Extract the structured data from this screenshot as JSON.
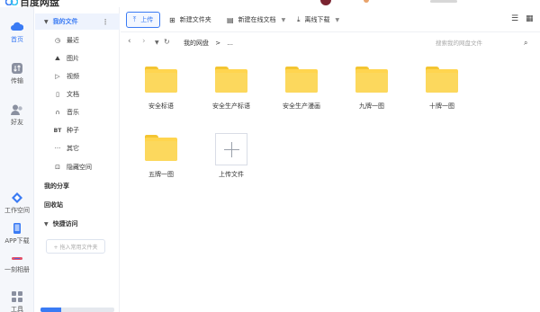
{
  "app": {
    "title": "百度网盘"
  },
  "rail": {
    "items": [
      {
        "label": "首页",
        "icon": "cloud-icon",
        "active": true
      },
      {
        "label": "传输",
        "icon": "transfer-icon",
        "active": false
      },
      {
        "label": "好友",
        "icon": "friends-icon",
        "active": false
      },
      {
        "label": "工作空间",
        "icon": "workspace-icon",
        "active": false
      },
      {
        "label": "APP下载",
        "icon": "phone-icon",
        "active": false
      },
      {
        "label": "一刻相册",
        "icon": "album-icon",
        "active": false
      },
      {
        "label": "工具",
        "icon": "tools-icon",
        "active": false
      }
    ]
  },
  "sidebar": {
    "my_files": "我的文件",
    "categories": [
      {
        "label": "最近",
        "icon": "clock-icon"
      },
      {
        "label": "图片",
        "icon": "image-icon"
      },
      {
        "label": "视频",
        "icon": "play-icon"
      },
      {
        "label": "文档",
        "icon": "document-icon"
      },
      {
        "label": "音乐",
        "icon": "headphones-icon"
      },
      {
        "label": "种子",
        "icon": "bt-icon"
      },
      {
        "label": "其它",
        "icon": "more-icon"
      },
      {
        "label": "隐藏空间",
        "icon": "lock-icon"
      }
    ],
    "my_share": "我的分享",
    "recycle_bin": "回收站",
    "quick_access": "快捷访问",
    "add_folder_hint": "+ 拖入常用文件夹",
    "storage_used_fraction": 0.28
  },
  "toolbar": {
    "upload": "上传",
    "new_folder": "新建文件夹",
    "new_online_doc": "新建在线文档",
    "offline_download": "离线下载"
  },
  "address": {
    "crumb_root": "我的网盘",
    "crumb_sep": ">",
    "crumb_more": "...",
    "search_placeholder": "搜索我的网盘文件"
  },
  "files": [
    {
      "name": "安全标语",
      "type": "folder"
    },
    {
      "name": "安全生产标语",
      "type": "folder"
    },
    {
      "name": "安全生产漫画",
      "type": "folder"
    },
    {
      "name": "九牌一图",
      "type": "folder"
    },
    {
      "name": "十牌一图",
      "type": "folder"
    },
    {
      "name": "五牌一图",
      "type": "folder"
    },
    {
      "name": "上传文件",
      "type": "upload"
    }
  ],
  "colors": {
    "accent": "#3a7bf4",
    "folder": "#ffd54f"
  }
}
